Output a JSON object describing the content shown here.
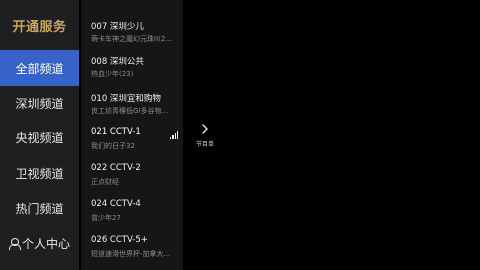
{
  "brand": {
    "label": "开通服务"
  },
  "categories": [
    {
      "label": "全部频道",
      "active": true
    },
    {
      "label": "深圳频道"
    },
    {
      "label": "央视频道"
    },
    {
      "label": "卫视频道"
    },
    {
      "label": "热门频道"
    },
    {
      "label": "个人中心",
      "icon": "user-icon"
    }
  ],
  "channels": [
    {
      "name": "007 深圳少儿",
      "program": "萌卡车神之魔幻元珠II(2..."
    },
    {
      "name": "008 深圳公共",
      "program": "热血少年(23)"
    },
    {
      "name": "010 深圳宜和购物",
      "program": "良工坊青稞低GI多谷物..."
    },
    {
      "name": "021 CCTV-1",
      "program": "我们的日子32",
      "current": true,
      "icon": "signal-icon"
    },
    {
      "name": "022 CCTV-2",
      "program": "正点财经"
    },
    {
      "name": "024 CCTV-4",
      "program": "曾少年27"
    },
    {
      "name": "026 CCTV-5+",
      "program": "短道速滑世界杯-加拿大..."
    }
  ],
  "program_panel": {
    "label": "节目单",
    "icon": "chevron-right-icon"
  },
  "colors": {
    "accent": "#3563c8",
    "brand": "#c9a65b",
    "sidebar": "#1f1f22",
    "list": "#161618"
  }
}
